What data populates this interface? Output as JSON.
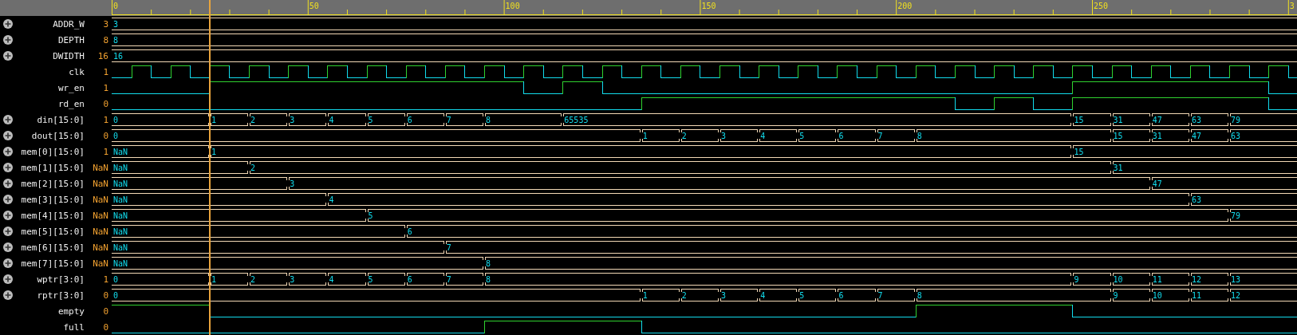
{
  "ruler": {
    "labels": [
      "0",
      "50",
      "100",
      "150",
      "200",
      "250",
      "3"
    ]
  },
  "signals": [
    {
      "name": "ADDR_W",
      "value": "3",
      "kind": "bus",
      "expandable": true,
      "values": [
        "3"
      ]
    },
    {
      "name": "DEPTH",
      "value": "8",
      "kind": "bus",
      "expandable": true,
      "values": [
        "8"
      ]
    },
    {
      "name": "DWIDTH",
      "value": "16",
      "kind": "bus",
      "expandable": true,
      "values": [
        "16"
      ]
    },
    {
      "name": "clk",
      "value": "1",
      "kind": "clock",
      "expandable": false
    },
    {
      "name": "wr_en",
      "value": "1",
      "kind": "bit",
      "expandable": false
    },
    {
      "name": "rd_en",
      "value": "0",
      "kind": "bit",
      "expandable": false
    },
    {
      "name": "din[15:0]",
      "value": "1",
      "kind": "bus",
      "expandable": true,
      "values": [
        "0",
        "1",
        "2",
        "3",
        "4",
        "5",
        "6",
        "7",
        "8",
        "65535",
        "15",
        "31",
        "47",
        "63",
        "79"
      ]
    },
    {
      "name": "dout[15:0]",
      "value": "0",
      "kind": "bus",
      "expandable": true,
      "values": [
        "0",
        "1",
        "2",
        "3",
        "4",
        "5",
        "6",
        "7",
        "8",
        "15",
        "31",
        "47",
        "63"
      ]
    },
    {
      "name": "mem[0][15:0]",
      "value": "1",
      "kind": "bus",
      "expandable": true,
      "values": [
        "NaN",
        "1",
        "15"
      ]
    },
    {
      "name": "mem[1][15:0]",
      "value": "NaN",
      "kind": "bus",
      "expandable": true,
      "values": [
        "NaN",
        "2",
        "31"
      ]
    },
    {
      "name": "mem[2][15:0]",
      "value": "NaN",
      "kind": "bus",
      "expandable": true,
      "values": [
        "NaN",
        "3",
        "47"
      ]
    },
    {
      "name": "mem[3][15:0]",
      "value": "NaN",
      "kind": "bus",
      "expandable": true,
      "values": [
        "NaN",
        "4",
        "63"
      ]
    },
    {
      "name": "mem[4][15:0]",
      "value": "NaN",
      "kind": "bus",
      "expandable": true,
      "values": [
        "NaN",
        "5",
        "79"
      ]
    },
    {
      "name": "mem[5][15:0]",
      "value": "NaN",
      "kind": "bus",
      "expandable": true,
      "values": [
        "NaN",
        "6"
      ]
    },
    {
      "name": "mem[6][15:0]",
      "value": "NaN",
      "kind": "bus",
      "expandable": true,
      "values": [
        "NaN",
        "7"
      ]
    },
    {
      "name": "mem[7][15:0]",
      "value": "NaN",
      "kind": "bus",
      "expandable": true,
      "values": [
        "NaN",
        "8"
      ]
    },
    {
      "name": "wptr[3:0]",
      "value": "1",
      "kind": "bus",
      "expandable": true,
      "values": [
        "0",
        "1",
        "2",
        "3",
        "4",
        "5",
        "6",
        "7",
        "8",
        "9",
        "10",
        "11",
        "12",
        "13"
      ]
    },
    {
      "name": "rptr[3:0]",
      "value": "0",
      "kind": "bus",
      "expandable": true,
      "values": [
        "0",
        "1",
        "2",
        "3",
        "4",
        "5",
        "6",
        "7",
        "8",
        "9",
        "10",
        "11",
        "12"
      ]
    },
    {
      "name": "empty",
      "value": "0",
      "kind": "bit",
      "expandable": false
    },
    {
      "name": "full",
      "value": "0",
      "kind": "bit",
      "expandable": false
    }
  ]
}
